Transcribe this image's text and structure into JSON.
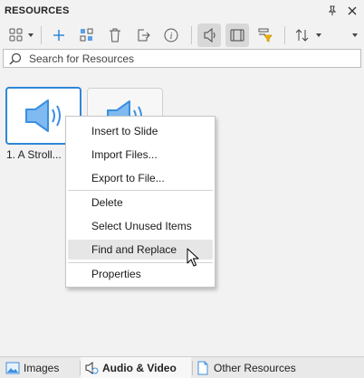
{
  "panel": {
    "title": "RESOURCES"
  },
  "header": {
    "pin_icon": "pin-icon",
    "close_icon": "close-icon"
  },
  "toolbar": {
    "buttons": [
      {
        "name": "view-options-button",
        "icon": "grid-view-icon",
        "has_dropdown": true
      },
      {
        "name": "add-button",
        "icon": "plus-icon"
      },
      {
        "name": "group-button",
        "icon": "group-icon"
      },
      {
        "name": "delete-button",
        "icon": "trash-icon"
      },
      {
        "name": "export-button",
        "icon": "export-icon"
      },
      {
        "name": "info-button",
        "icon": "info-icon"
      },
      {
        "name": "audio-filter-button",
        "icon": "speaker-icon",
        "active": true
      },
      {
        "name": "video-filter-button",
        "icon": "film-icon",
        "active": true
      },
      {
        "name": "filter-button",
        "icon": "filter-icon"
      },
      {
        "name": "sort-button",
        "icon": "sort-icon",
        "has_dropdown": true
      },
      {
        "name": "more-button",
        "icon": "chevron-down-icon"
      }
    ]
  },
  "search": {
    "placeholder": "Search for Resources",
    "value": ""
  },
  "items": [
    {
      "label": "1. A Stroll...",
      "icon": "speaker-icon",
      "selected": true
    },
    {
      "label": "",
      "icon": "speaker-icon",
      "selected": false
    }
  ],
  "context_menu": {
    "items": [
      {
        "label": "Insert to Slide"
      },
      {
        "label": "Import Files..."
      },
      {
        "label": "Export to File..."
      },
      {
        "label": "Delete"
      },
      {
        "label": "Select Unused Items"
      },
      {
        "label": "Find and Replace",
        "hovered": true
      },
      {
        "label": "Properties"
      }
    ]
  },
  "tabs": [
    {
      "label": "Images",
      "icon": "image-icon",
      "active": false
    },
    {
      "label": "Audio & Video",
      "icon": "media-icon",
      "active": true
    },
    {
      "label": "Other Resources",
      "icon": "document-icon",
      "active": false
    }
  ],
  "colors": {
    "accent": "#2f86d8",
    "speaker": "#3b8fe0",
    "hover": "#e6e6e6"
  }
}
